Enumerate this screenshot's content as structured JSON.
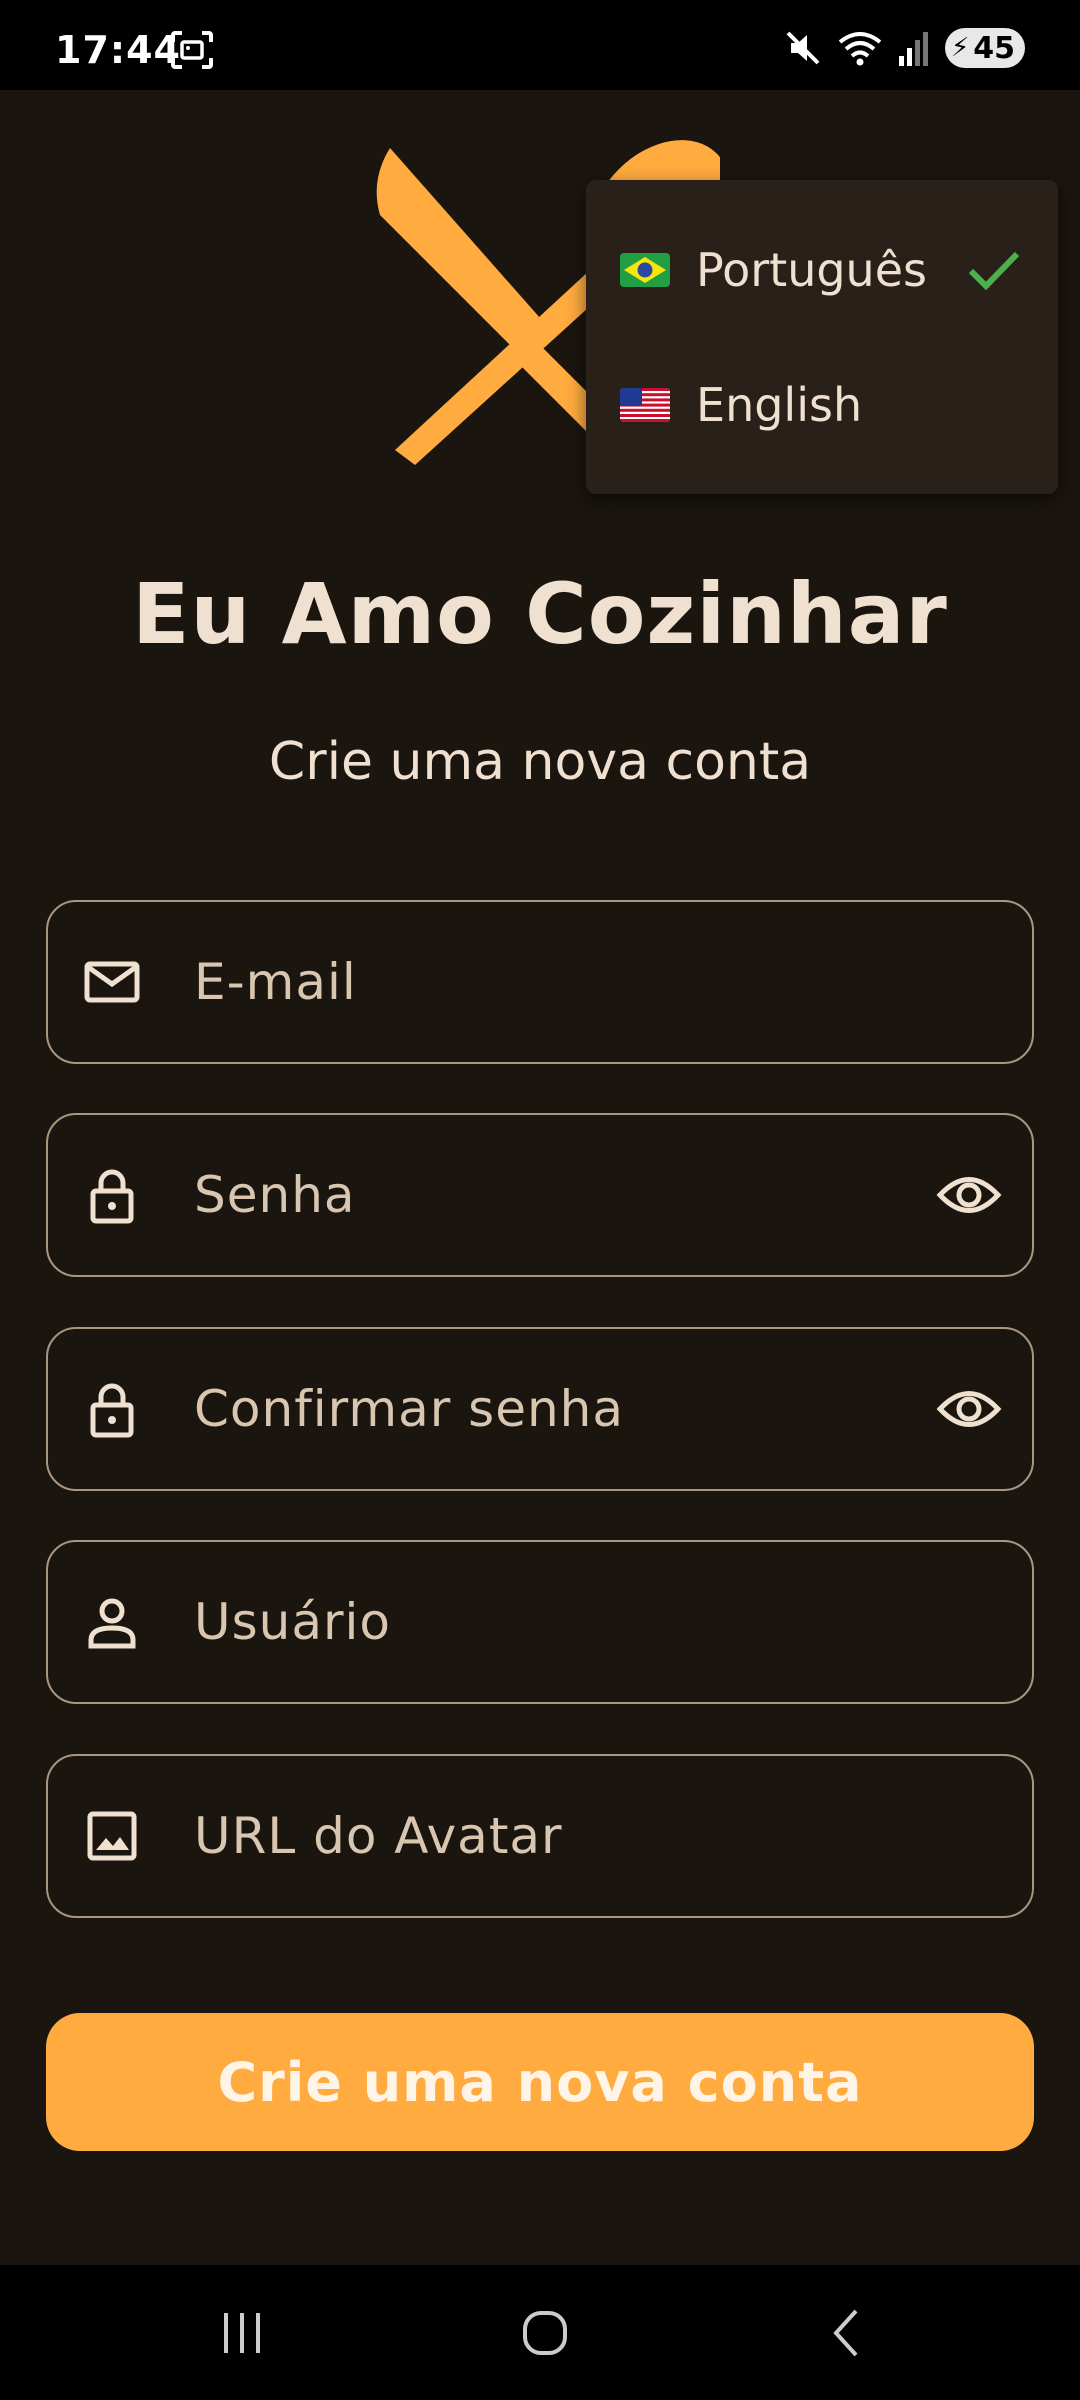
{
  "status_bar": {
    "time": "17:44",
    "battery_level": "45",
    "icons": [
      "screenshot-icon",
      "mute-icon",
      "wifi-icon",
      "signal-icon",
      "battery-charging-icon"
    ]
  },
  "app": {
    "title": "Eu Amo Cozinhar",
    "subtitle": "Crie uma nova conta"
  },
  "form": {
    "email": {
      "placeholder": "E-mail",
      "value": "",
      "icon": "mail-icon"
    },
    "password": {
      "placeholder": "Senha",
      "value": "",
      "icon": "lock-icon",
      "trailing_icon": "eye-icon"
    },
    "confirm_password": {
      "placeholder": "Confirmar senha",
      "value": "",
      "icon": "lock-icon",
      "trailing_icon": "eye-icon"
    },
    "username": {
      "placeholder": "Usuário",
      "value": "",
      "icon": "person-icon"
    },
    "avatar_url": {
      "placeholder": "URL do Avatar",
      "value": "",
      "icon": "image-icon"
    },
    "submit_label": "Crie uma nova conta"
  },
  "language_menu": {
    "items": [
      {
        "label": "Português",
        "flag": "brazil-flag",
        "selected": true
      },
      {
        "label": "English",
        "flag": "usa-flag",
        "selected": false
      }
    ]
  },
  "colors": {
    "background": "#1b1510",
    "accent": "#ffab40",
    "text": "#efe0cf",
    "field_border": "#a89681",
    "menu_background": "#292119",
    "check": "#4caf50"
  },
  "nav_bar": {
    "buttons": [
      "recents-icon",
      "home-icon",
      "back-icon"
    ]
  }
}
